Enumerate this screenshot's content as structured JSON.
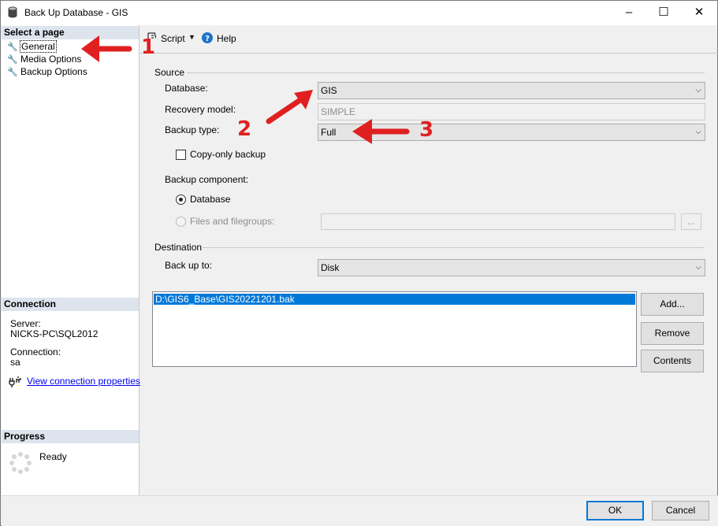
{
  "window": {
    "title": "Back Up Database - GIS",
    "minimize": "–",
    "maximize": "☐",
    "close": "✕"
  },
  "sidebar": {
    "select_page_heading": "Select a page",
    "items": [
      {
        "label": "General",
        "icon": "wrench-icon"
      },
      {
        "label": "Media Options",
        "icon": "wrench-icon"
      },
      {
        "label": "Backup Options",
        "icon": "wrench-icon"
      }
    ],
    "connection_heading": "Connection",
    "server_label": "Server:",
    "server_value": "NICKS-PC\\SQL2012",
    "connection_label": "Connection:",
    "connection_value": "sa",
    "view_connection_link": "View connection properties",
    "progress_heading": "Progress",
    "progress_status": "Ready"
  },
  "toolbar": {
    "script_label": "Script",
    "help_label": "Help"
  },
  "source": {
    "heading": "Source",
    "database_label": "Database:",
    "database_value": "GIS",
    "recovery_label": "Recovery model:",
    "recovery_value": "SIMPLE",
    "backup_type_label": "Backup type:",
    "backup_type_value": "Full",
    "copy_only_label": "Copy-only backup",
    "copy_only_checked": false,
    "component_label": "Backup component:",
    "component_database": "Database",
    "component_files": "Files and filegroups:",
    "files_button": "..."
  },
  "destination": {
    "heading": "Destination",
    "backup_to_label": "Back up to:",
    "backup_to_value": "Disk",
    "files": [
      "D:\\GIS6_Base\\GIS20221201.bak"
    ],
    "add_button": "Add...",
    "remove_button": "Remove",
    "contents_button": "Contents"
  },
  "footer": {
    "ok_button": "OK",
    "cancel_button": "Cancel"
  },
  "annotations": {
    "marker_1": "1",
    "marker_2": "2",
    "marker_3": "3",
    "color": "#e02020"
  }
}
